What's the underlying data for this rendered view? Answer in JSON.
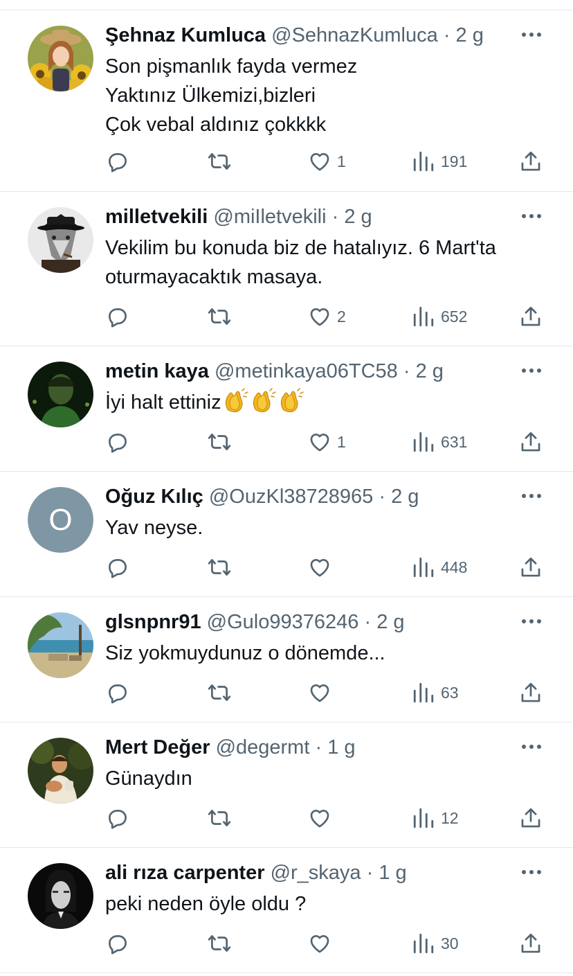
{
  "tweets": [
    {
      "name": "Şehnaz Kumluca",
      "handle": "@SehnazKumluca",
      "dot": "·",
      "time": "2 g",
      "lines": [
        "Son pişmanlık fayda vermez",
        "Yaktınız Ülkemizi,bizleri",
        "Çok vebal aldınız çokkkk"
      ],
      "likes": "1",
      "views": "191",
      "avatar": "sunflower-photo"
    },
    {
      "name": "milletvekili",
      "handle": "@miIletvekili",
      "dot": "·",
      "time": "2 g",
      "lines": [
        "Vekilim bu konuda biz de hatalıyız. 6 Mart'ta",
        "oturmayacaktık masaya."
      ],
      "likes": "2",
      "views": "652",
      "avatar": "wolf-in-hat"
    },
    {
      "name": "metin kaya",
      "handle": "@metinkaya06TC58",
      "dot": "·",
      "time": "2 g",
      "lines": [
        "İyi halt ettiniz"
      ],
      "emoji": "clapping-hands",
      "likes": "1",
      "views": "631",
      "avatar": "dark-portrait"
    },
    {
      "name": "Oğuz Kılıç",
      "handle": "@OuzKl38728965",
      "dot": "·",
      "time": "2 g",
      "lines": [
        "Yav neyse."
      ],
      "likes": "",
      "views": "448",
      "avatar_letter": "O"
    },
    {
      "name": "glsnpnr91",
      "handle": "@Gulo99376246",
      "dot": "·",
      "time": "2 g",
      "lines": [
        "Siz yokmuydunuz o dönemde..."
      ],
      "likes": "",
      "views": "63",
      "avatar": "seaside-landscape"
    },
    {
      "name": "Mert Değer",
      "handle": "@degermt",
      "dot": "·",
      "time": "1 g",
      "lines": [
        "Günaydın"
      ],
      "likes": "",
      "views": "12",
      "avatar": "person-outdoors"
    },
    {
      "name": "ali rıza carpenter",
      "handle": "@r_skaya",
      "dot": "·",
      "time": "1 g",
      "lines": [
        "peki neden öyle oldu ?"
      ],
      "likes": "",
      "views": "30",
      "avatar": "bw-portrait"
    }
  ],
  "colors": {
    "text": "#0f1419",
    "secondary": "#536471",
    "divider": "#e3e7ea",
    "letter_avatar_bg": "#7f96a4"
  }
}
